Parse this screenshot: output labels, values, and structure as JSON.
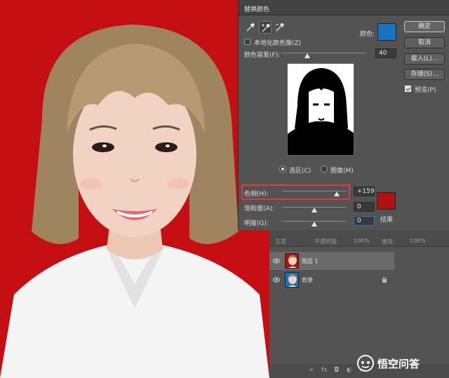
{
  "dialog": {
    "title": "替换颜色",
    "localized_clusters_label": "本地化颜色簇(Z)",
    "color_label": "颜色:",
    "fuzziness_label": "颜色容差(F):",
    "fuzziness_value": "40",
    "fuzziness_level_pct": 30,
    "selection_color": "#1673c0",
    "view_selection_label": "选区(C)",
    "view_image_label": "图像(M)",
    "hue_label": "色相(H):",
    "hue_value": "+159",
    "hue_level_pct": 85,
    "saturation_label": "饱和度(A):",
    "saturation_value": "0",
    "saturation_level_pct": 50,
    "lightness_label": "明度(G):",
    "lightness_value": "0",
    "lightness_level_pct": 50,
    "result_label": "结果",
    "result_color": "#b01210",
    "buttons": {
      "ok": "确定",
      "cancel": "取消",
      "load": "载入(L)...",
      "save": "存储(S)..."
    },
    "preview_label": "预览(P)"
  },
  "layers_panel": {
    "opacity_label": "不透明度:",
    "opacity_value": "100%",
    "fill_label": "填充:",
    "fill_value": "100%",
    "layers": [
      {
        "name": "图层 1",
        "active": true,
        "locked": false
      },
      {
        "name": "背景",
        "active": false,
        "locked": true
      }
    ],
    "footer_icons": [
      "link-icon",
      "fx-icon",
      "mask-icon",
      "adjustment-icon",
      "folder-icon"
    ]
  },
  "watermark": {
    "text": "悟空问答"
  },
  "colors": {
    "canvas_bg": "#c40e12",
    "panel_bg": "#535353",
    "highlight": "#e53a3a"
  }
}
